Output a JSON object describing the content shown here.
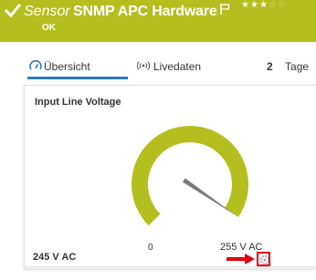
{
  "header": {
    "prefix": "Sensor",
    "name": "SNMP APC Hardware",
    "status": "OK",
    "priority_stars": 3,
    "stars_total": 5,
    "color": "#b4be1e",
    "icons": [
      "check-icon",
      "flag-icon"
    ]
  },
  "tabs": [
    {
      "label": "Übersicht",
      "icon": "overview-icon",
      "active": true
    },
    {
      "label": "Livedaten",
      "icon": "live-icon",
      "active": false
    },
    {
      "number": "2",
      "label": "Tage",
      "active": false
    }
  ],
  "panel": {
    "title": "Input Line Voltage",
    "value": "245 V AC",
    "min_label": "0",
    "max_label": "255 V AC",
    "gauge_fraction": 0.96,
    "gauge_color": "#b4be1e",
    "annotation_color": "#e00010"
  }
}
